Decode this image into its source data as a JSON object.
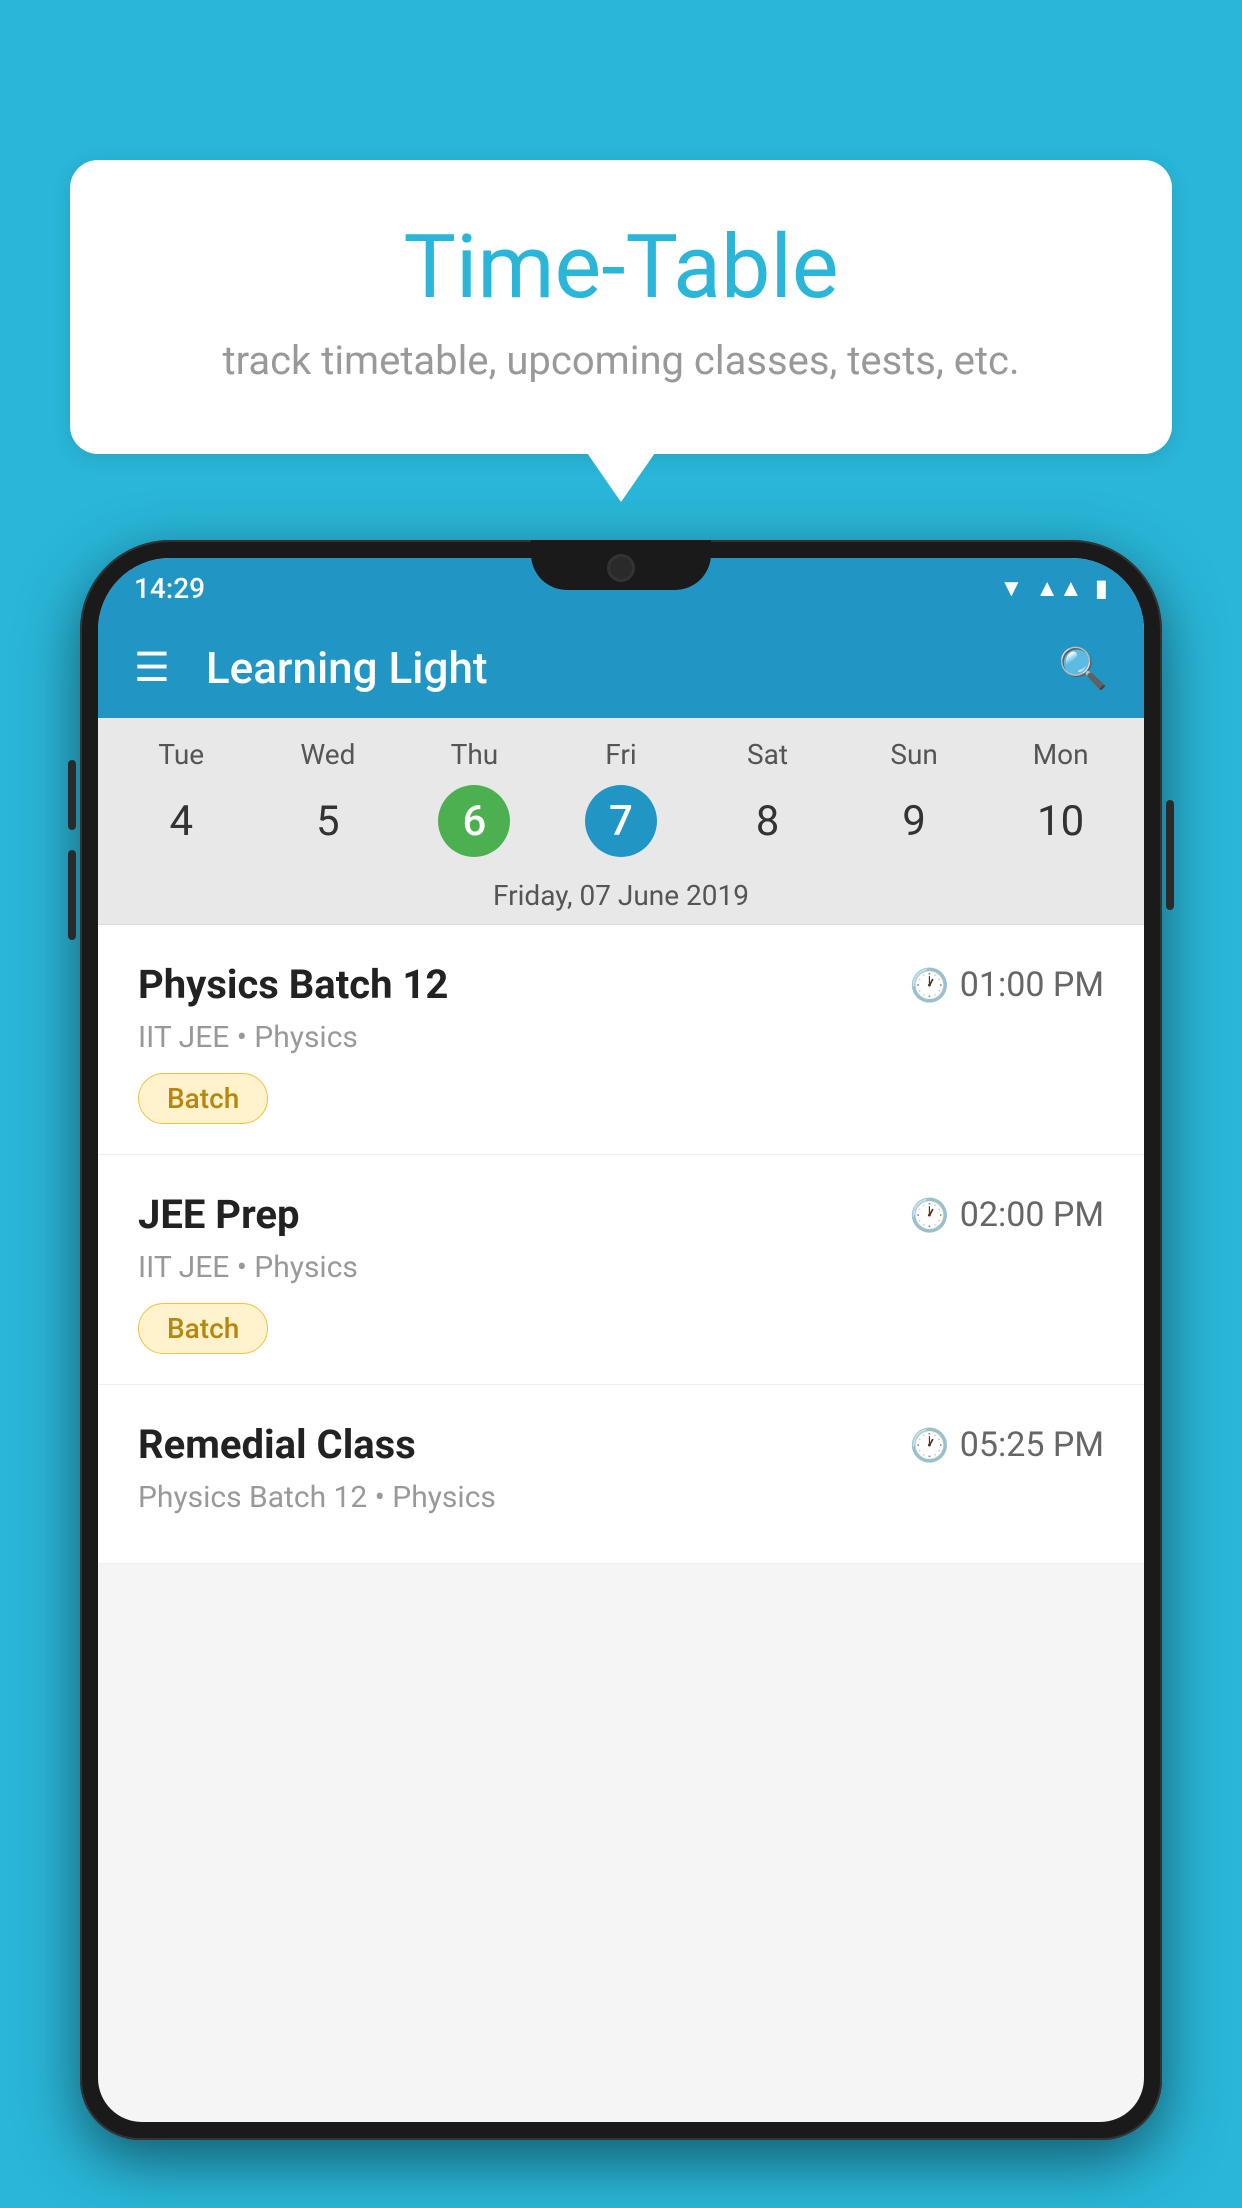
{
  "background_color": "#29b6d8",
  "speech_bubble": {
    "title": "Time-Table",
    "subtitle": "track timetable, upcoming classes, tests, etc."
  },
  "phone": {
    "status_bar": {
      "time": "14:29"
    },
    "app_bar": {
      "title": "Learning Light"
    },
    "calendar": {
      "days": [
        {
          "name": "Tue",
          "num": "4",
          "state": "normal"
        },
        {
          "name": "Wed",
          "num": "5",
          "state": "normal"
        },
        {
          "name": "Thu",
          "num": "6",
          "state": "today"
        },
        {
          "name": "Fri",
          "num": "7",
          "state": "selected"
        },
        {
          "name": "Sat",
          "num": "8",
          "state": "normal"
        },
        {
          "name": "Sun",
          "num": "9",
          "state": "normal"
        },
        {
          "name": "Mon",
          "num": "10",
          "state": "normal"
        }
      ],
      "selected_date_label": "Friday, 07 June 2019"
    },
    "schedule_items": [
      {
        "name": "Physics Batch 12",
        "time": "01:00 PM",
        "meta": "IIT JEE • Physics",
        "badge": "Batch"
      },
      {
        "name": "JEE Prep",
        "time": "02:00 PM",
        "meta": "IIT JEE • Physics",
        "badge": "Batch"
      },
      {
        "name": "Remedial Class",
        "time": "05:25 PM",
        "meta": "Physics Batch 12 • Physics",
        "badge": null
      }
    ]
  }
}
